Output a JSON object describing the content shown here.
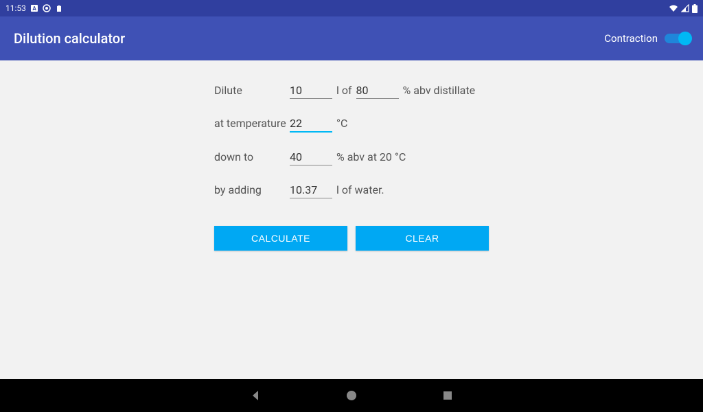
{
  "status_bar": {
    "time": "11:53"
  },
  "app_bar": {
    "title": "Dilution calculator",
    "toggle_label": "Contraction"
  },
  "form": {
    "dilute_label": "Dilute",
    "volume": "10",
    "l_of": "l of",
    "abv_initial": "80",
    "abv_distillate": "% abv distillate",
    "at_temp_label": "at temperature",
    "temperature": "22",
    "celsius": "°C",
    "down_to_label": "down to",
    "abv_target": "40",
    "abv_at_20": "% abv at 20 °C",
    "by_adding_label": "by adding",
    "water_volume": "10.37",
    "l_water": "l of water."
  },
  "buttons": {
    "calculate": "CALCULATE",
    "clear": "CLEAR"
  }
}
